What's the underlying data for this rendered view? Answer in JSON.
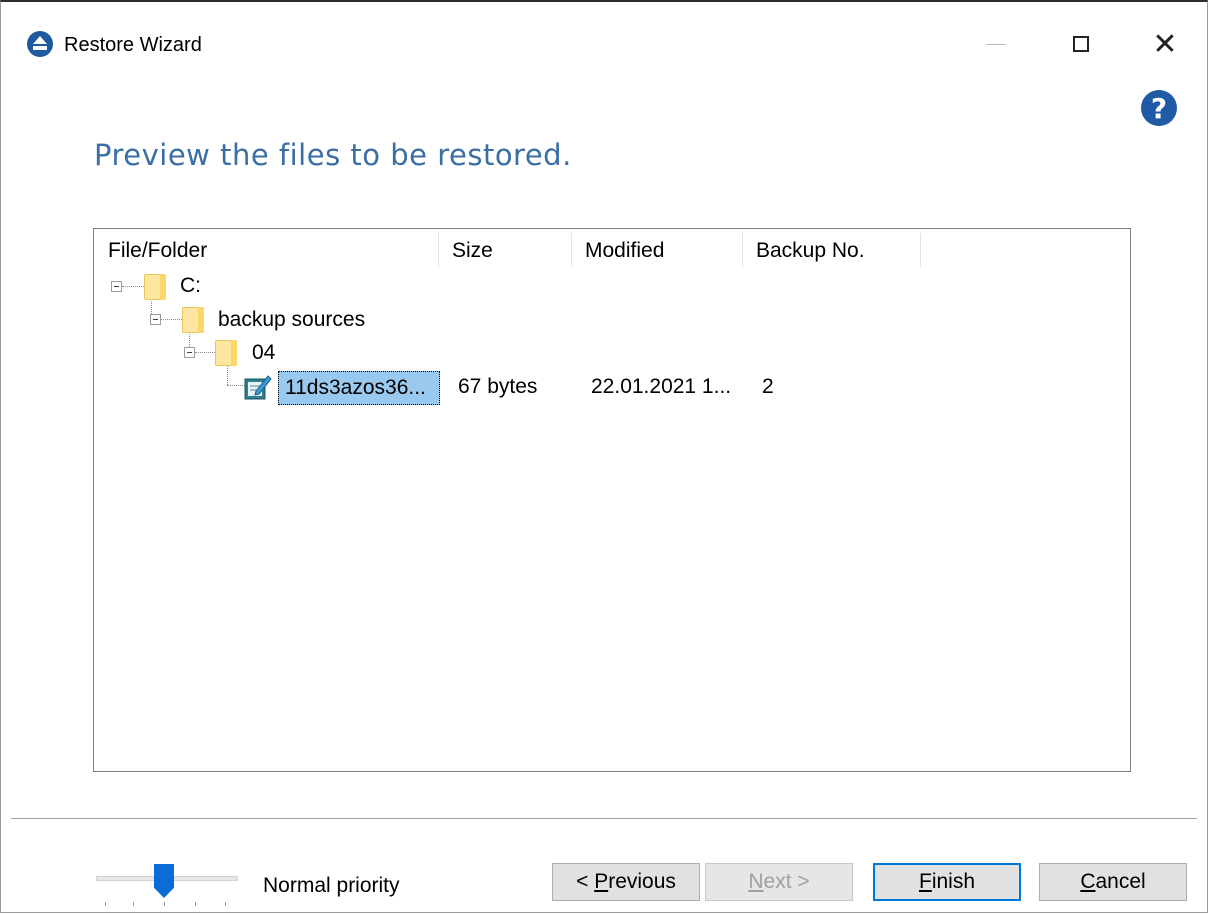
{
  "window": {
    "title": "Restore Wizard",
    "close_glyph": "✕"
  },
  "help_glyph": "?",
  "page_title": "Preview the files to be restored.",
  "table": {
    "columns": [
      "File/Folder",
      "Size",
      "Modified",
      "Backup No."
    ],
    "tree": [
      {
        "label": "C:",
        "level": 0,
        "icon": "folder-icon"
      },
      {
        "label": "backup sources",
        "level": 1,
        "icon": "folder-icon"
      },
      {
        "label": "04",
        "level": 2,
        "icon": "folder-icon"
      },
      {
        "label": "11ds3azos36...",
        "level": 3,
        "icon": "text-file-icon",
        "size": "67 bytes",
        "modified": "22.01.2021 1...",
        "backup_no": "2",
        "selected": true
      }
    ]
  },
  "footer": {
    "priority_label": "Normal priority",
    "previous_label": "< Previous",
    "previous_accel": "P",
    "next_label": "Next >",
    "next_accel": "N",
    "finish_label": "Finish",
    "finish_accel": "F",
    "cancel_label": "Cancel",
    "cancel_accel": "C"
  },
  "colors": {
    "title_blue": "#3a6ea5",
    "selection": "#99c9ef",
    "accent": "#0078d7"
  }
}
